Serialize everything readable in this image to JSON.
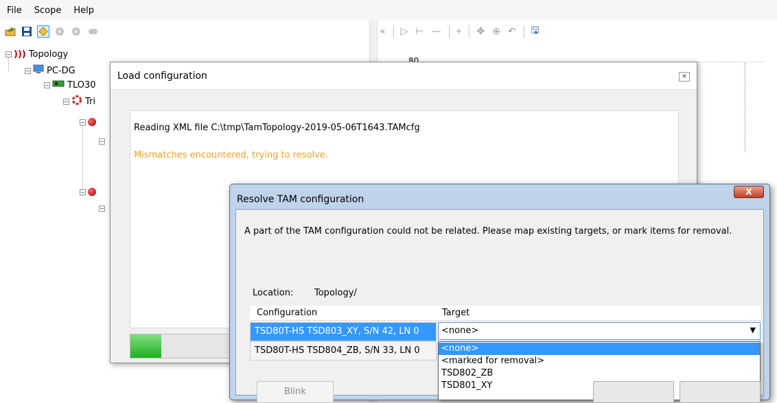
{
  "menu": [
    "File",
    "Scope",
    "Help"
  ],
  "toolbar_left_icons": [
    "open-icon",
    "save-icon",
    "diamond-icon",
    "gear-gray-icon",
    "gear-gray-icon",
    "gear-gray-icon"
  ],
  "toolbar_right": {
    "collapse": "«",
    "play": "▷",
    "step": "⊢",
    "dash": "—",
    "crosshair": "⌖",
    "move": "✥",
    "zoom": "⊕",
    "undo": "↶",
    "save": "🖫"
  },
  "tree": {
    "topology": "Topology",
    "pc": "PC-DG",
    "tlo": "TLO30",
    "tri": "Tri"
  },
  "chart": {
    "y_tick": "80"
  },
  "load_dialog": {
    "title": "Load configuration",
    "close": "✕",
    "line1": "Reading XML file C:\\tmp\\TamTopology-2019-05-06T1643.TAMcfg",
    "line2": "Mismatches encountered, trying to resolve.",
    "progress_fraction": 0.24
  },
  "resolve_dialog": {
    "title": "Resolve TAM configuration",
    "close": "X",
    "message": "A part of the TAM configuration could not be related. Please map existing targets, or mark items for removal.",
    "location_label": "Location:",
    "location_value": "Topology/",
    "columns": [
      "Configuration",
      "Target"
    ],
    "rows": [
      "TSD80T-HS TSD803_XY, S/N 42, LN 0",
      "TSD80T-HS TSD804_ZB, S/N 33, LN 0"
    ],
    "combo_value": "<none>",
    "options": [
      "<none>",
      "<marked for removal>",
      "TSD802_ZB",
      "TSD801_XY"
    ],
    "blink_label": "Blink"
  },
  "colors": {
    "selected": "#3399ff",
    "warning_text": "#f0a020",
    "progress": "#1fb01f"
  }
}
